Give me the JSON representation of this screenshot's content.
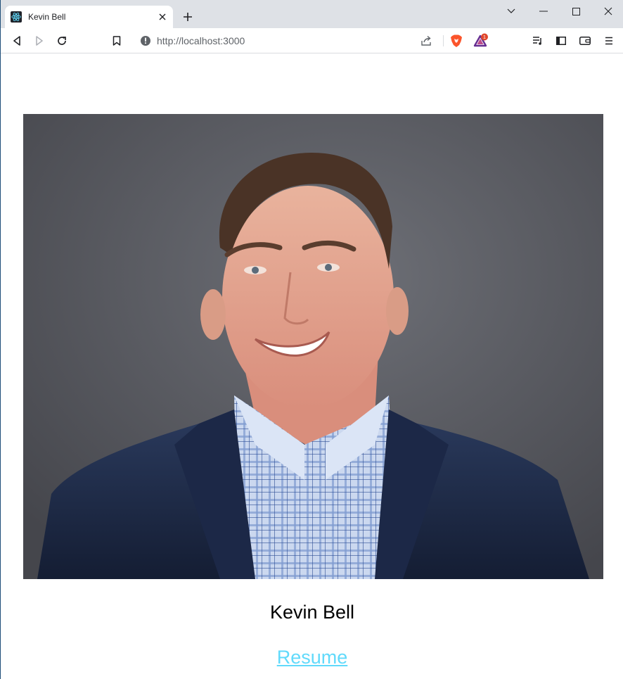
{
  "browser": {
    "tab": {
      "title": "Kevin Bell",
      "favicon": "react-icon"
    },
    "address_bar": {
      "url": "http://localhost:3000"
    },
    "rewards_badge": "1"
  },
  "page": {
    "portrait": {
      "alt": "Kevin Bell"
    },
    "name": "Kevin Bell",
    "resume_link": "Resume",
    "link_color": "#61dafb"
  }
}
